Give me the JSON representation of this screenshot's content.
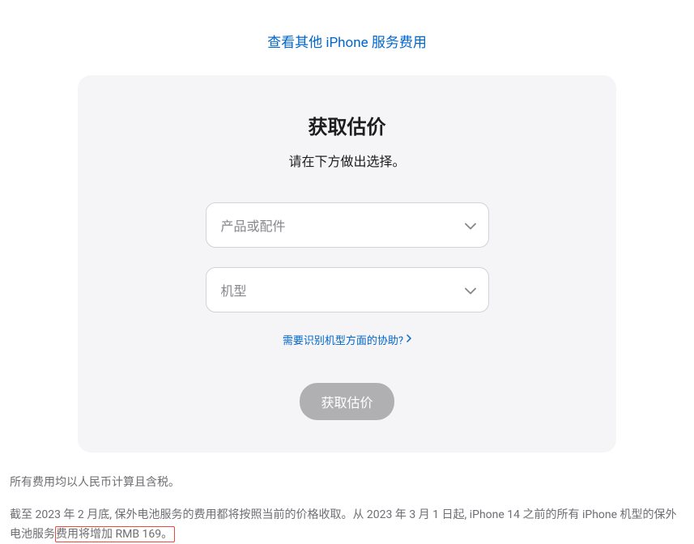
{
  "topLink": {
    "label": "查看其他 iPhone 服务费用"
  },
  "card": {
    "title": "获取估价",
    "subtitle": "请在下方做出选择。",
    "select1": {
      "placeholder": "产品或配件"
    },
    "select2": {
      "placeholder": "机型"
    },
    "helpLink": "需要识别机型方面的协助?",
    "submit": "获取估价"
  },
  "footer": {
    "line1": "所有费用均以人民币计算且含税。",
    "line2_part1": "截至 2023 年 2 月底, 保外电池服务的费用都将按照当前的价格收取。从 2023 年 3 月 1 日起, iPhone 14 之前的所有 iPhone 机型的保外电池服",
    "line2_part2a": "务",
    "line2_part2b": "费用将增加 RMB 169。"
  }
}
